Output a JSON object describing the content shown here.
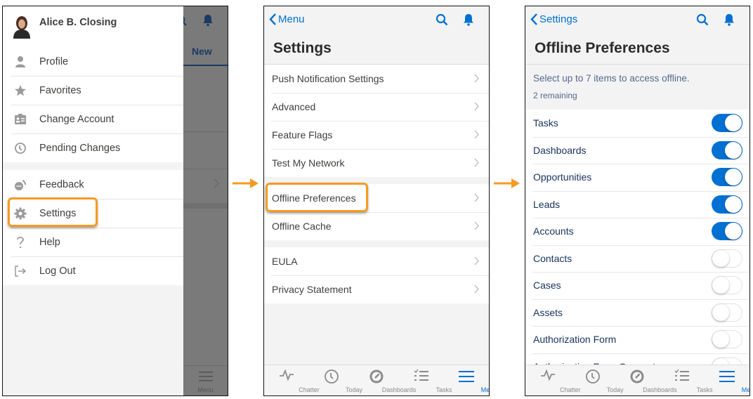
{
  "panel1": {
    "user_name": "Alice B. Closing",
    "groups": [
      [
        {
          "label": "Profile",
          "icon": "user-icon"
        },
        {
          "label": "Favorites",
          "icon": "star-icon"
        },
        {
          "label": "Change Account",
          "icon": "id-card-icon"
        },
        {
          "label": "Pending Changes",
          "icon": "clock-icon"
        }
      ],
      [
        {
          "label": "Feedback",
          "icon": "feedback-icon"
        },
        {
          "label": "Settings",
          "icon": "gear-icon"
        },
        {
          "label": "Help",
          "icon": "question-icon"
        },
        {
          "label": "Log Out",
          "icon": "logout-icon"
        }
      ]
    ],
    "background": {
      "new_label": "New",
      "menu_label": "Menu"
    }
  },
  "panel2": {
    "back_label": "Menu",
    "title": "Settings",
    "sections": [
      [
        "Push Notification Settings",
        "Advanced",
        "Feature Flags",
        "Test My Network"
      ],
      [
        "Offline Preferences",
        "Offline Cache"
      ],
      [
        "EULA",
        "Privacy Statement"
      ]
    ]
  },
  "panel3": {
    "back_label": "Settings",
    "title": "Offline Preferences",
    "info_text": "Select up to 7 items to access offline.",
    "remaining_text": "2 remaining",
    "items": [
      {
        "label": "Tasks",
        "enabled": true
      },
      {
        "label": "Dashboards",
        "enabled": true
      },
      {
        "label": "Opportunities",
        "enabled": true
      },
      {
        "label": "Leads",
        "enabled": true
      },
      {
        "label": "Accounts",
        "enabled": true
      },
      {
        "label": "Contacts",
        "enabled": false
      },
      {
        "label": "Cases",
        "enabled": false
      },
      {
        "label": "Assets",
        "enabled": false
      },
      {
        "label": "Authorization Form",
        "enabled": false
      },
      {
        "label": "Authorization Form Consent",
        "enabled": false
      }
    ]
  },
  "tabbar": [
    {
      "label": "Chatter",
      "icon": "chatter-pulse-icon"
    },
    {
      "label": "Today",
      "icon": "clock-icon"
    },
    {
      "label": "Dashboards",
      "icon": "gauge-icon"
    },
    {
      "label": "Tasks",
      "icon": "task-list-icon"
    },
    {
      "label": "Menu",
      "icon": "hamburger-menu-icon",
      "active": true
    }
  ],
  "colors": {
    "accent": "#0070d2",
    "highlight": "#f59a23",
    "text": "#3e3e3c",
    "overlay": "#7a7a7a"
  }
}
